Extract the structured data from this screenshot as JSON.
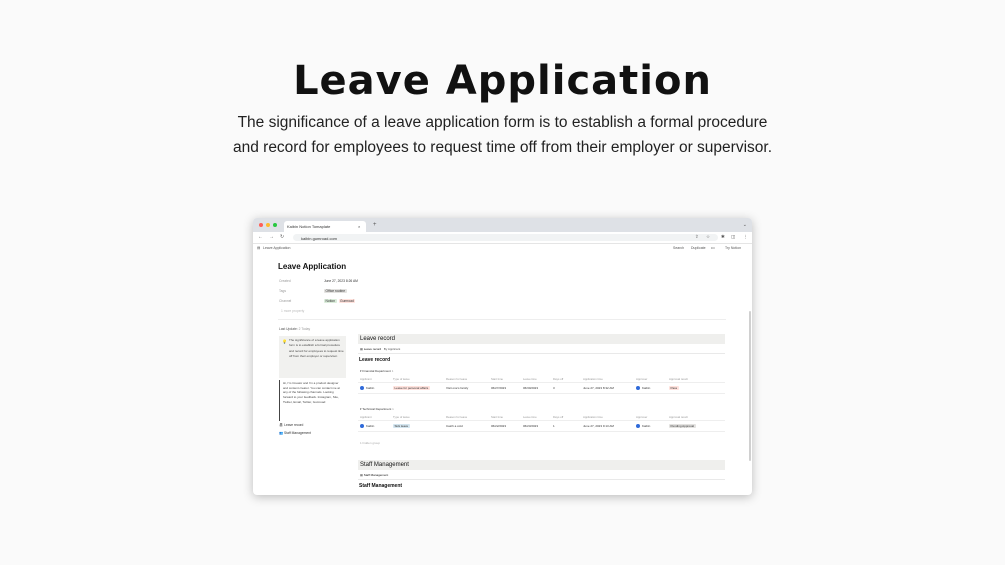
{
  "hero": {
    "title": "Leave Application",
    "subtitle": "The significance of a leave application form is to establish a formal procedure and record for employees to request time off from their employer or supervisor."
  },
  "browser": {
    "tab_title": "Kaibin Notion Tomaplate",
    "tab_close": "×",
    "new_tab": "+",
    "url": "kaibin.gumroad.com"
  },
  "notion_topbar": {
    "breadcrumb": "Leave Application",
    "search": "Search",
    "duplicate": "Duplicate",
    "more": "•••",
    "try_notion": "Try Notion"
  },
  "page": {
    "title": "Leave Application",
    "properties": [
      {
        "name": "Created",
        "value": "June 27, 2023 8:26 AM"
      },
      {
        "name": "Tags",
        "value": "Office routine"
      },
      {
        "name": "Channel",
        "tags": [
          "Notion",
          "Gumroad"
        ]
      }
    ],
    "more_props": "1 more property",
    "last_update_label": "Last Update:",
    "last_update_value": "2 Today",
    "callout_icon": "💡",
    "callout_text": "The significance of a leave application form is to establish a formal procedure and record for employees to request time off from their employer or supervisor.",
    "quote_text": "Hi, I'm Creator and I'm a product designer and content creator. You can contact me at any of the following channels. Looking forward to your feedback. Instagram, Site, Twitter, Email, Twitter, Gumroad",
    "side_links": [
      "Leave record",
      "Staff Management"
    ]
  },
  "leave_section": {
    "heading": "Leave record",
    "views": [
      "Leave record",
      "By Applicant"
    ],
    "db_title": "Leave record",
    "columns": [
      "Applicant",
      "Type of leave",
      "Reason for leave",
      "Start time",
      "Leave time",
      "Days off",
      "Application time",
      "Approver",
      "Approval result"
    ],
    "groups": [
      {
        "name": "Financial Department",
        "count": "1",
        "row": {
          "applicant": "Kaibin",
          "type": "Leave for personal affairs",
          "reason": "Visit one's family",
          "start": "06/27/2023",
          "leave": "06/30/2023",
          "days": "3",
          "app_time": "June 27, 2023 8:32 AM",
          "approver": "Kaibin",
          "result": "Pass"
        }
      },
      {
        "name": "Technical Department",
        "count": "1",
        "row": {
          "applicant": "Kaibin",
          "type": "Sick leave",
          "reason": "Catch a cold",
          "start": "06/22/2023",
          "leave": "06/23/2023",
          "days": "1",
          "app_time": "June 27, 2023 9:13 AM",
          "approver": "Kaibin",
          "result": "Pending Approval"
        }
      }
    ],
    "hidden_group": "1 hidden group"
  },
  "staff_section": {
    "heading": "Staff Management",
    "view": "Staff Management",
    "db_title": "Staff Management"
  }
}
